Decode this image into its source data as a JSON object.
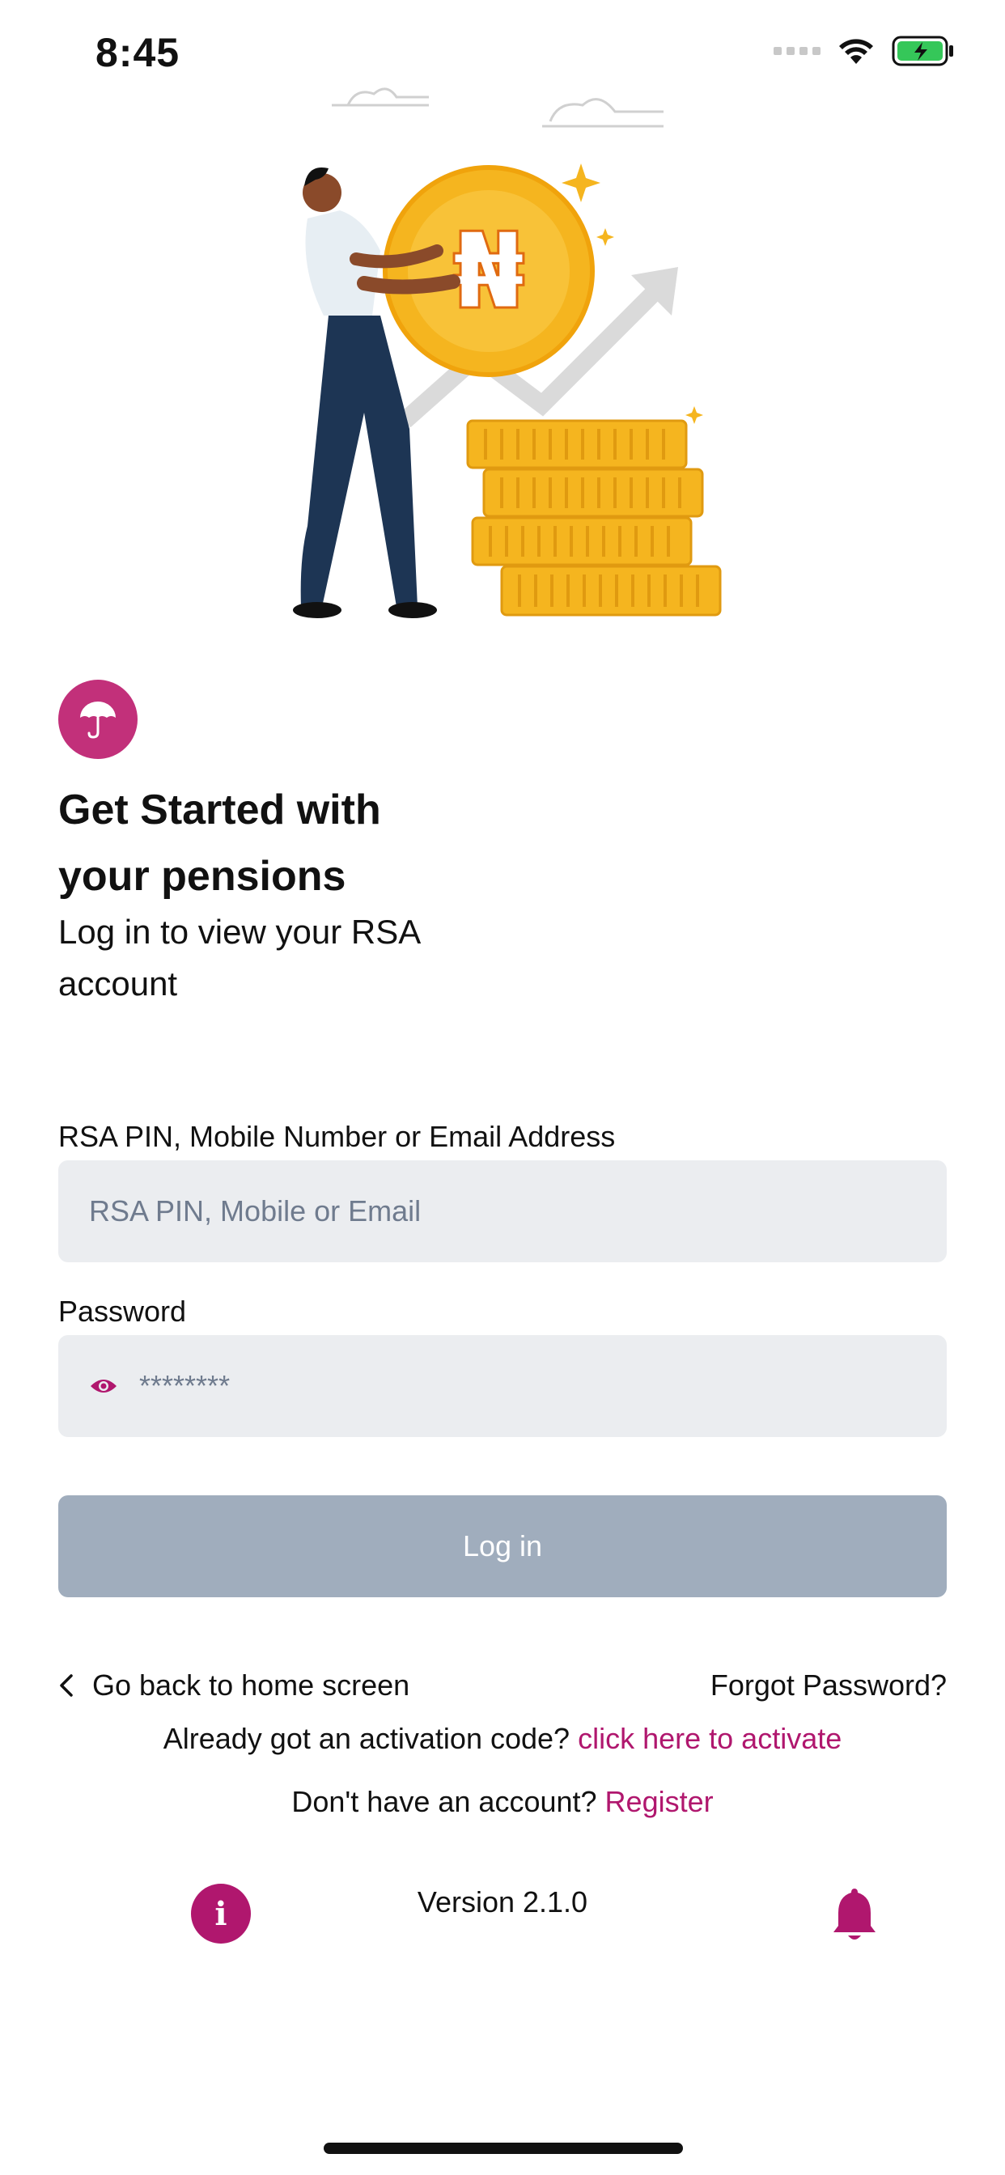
{
  "status_bar": {
    "time": "8:45"
  },
  "hero": {
    "currency_symbol": "₦"
  },
  "header": {
    "title_line1": "Get Started with",
    "title_line2": "your pensions",
    "subtitle_line1": "Log in to view your RSA",
    "subtitle_line2": "account"
  },
  "form": {
    "identifier_label": "RSA PIN, Mobile Number or Email Address",
    "identifier_placeholder": "RSA PIN, Mobile or Email",
    "password_label": "Password",
    "password_placeholder": "********",
    "login_label": "Log in"
  },
  "links": {
    "back_label": "Go back to home screen",
    "forgot_label": "Forgot Password?",
    "activation_prompt": "Already got an activation code?",
    "activation_link": "click here to activate",
    "register_prompt": "Don't have an account?",
    "register_link": "Register"
  },
  "footer": {
    "version": "Version 2.1.0"
  },
  "colors": {
    "accent": "#b0176e",
    "badge": "#c2307a",
    "field_bg": "#ebedf0",
    "button_disabled": "#a0adbd"
  },
  "icons": [
    "wifi-icon",
    "battery-charging-icon",
    "umbrella-icon",
    "eye-icon",
    "chevron-left-icon",
    "info-icon",
    "bell-icon"
  ]
}
